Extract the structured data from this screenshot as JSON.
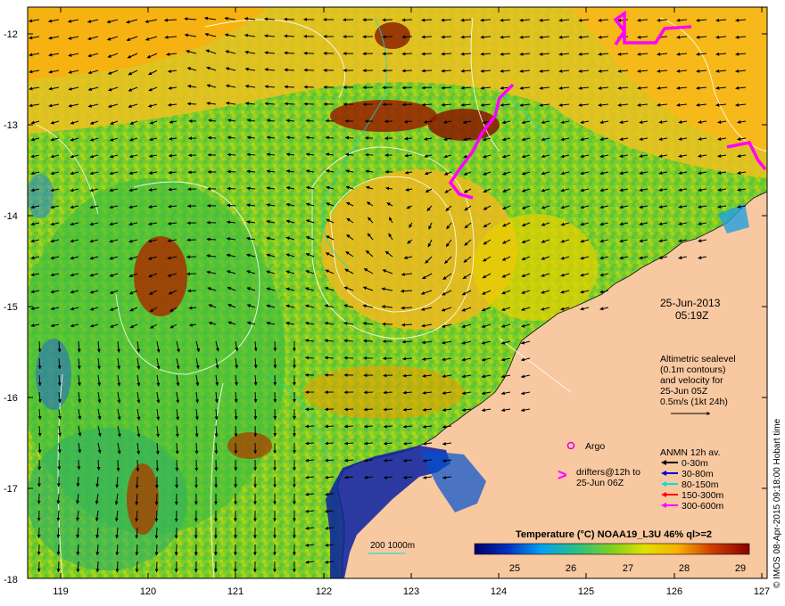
{
  "map": {
    "date": "25-Jun-2013",
    "time": "05:19Z",
    "lon_ticks": [
      "119",
      "120",
      "121",
      "122",
      "123",
      "124",
      "125",
      "126",
      "127"
    ],
    "lat_ticks": [
      "-12",
      "-13",
      "-14",
      "-15",
      "-16",
      "-17",
      "-18"
    ],
    "altimetry_lines": [
      "Altimetric sealevel",
      "(0.1m contours)",
      "and velocity for",
      "25-Jun 05Z",
      "0.5m/s (1kt 24h)"
    ],
    "argo_label": "Argo",
    "drifters_lines": [
      "drifters@12h to",
      "25-Jun 06Z"
    ],
    "anmn_title": "ANMN 12h av.",
    "anmn_items": [
      {
        "label": "0-30m",
        "color": "#000000"
      },
      {
        "label": "30-80m",
        "color": "#0000cc"
      },
      {
        "label": "80-150m",
        "color": "#00e0e0"
      },
      {
        "label": "150-300m",
        "color": "#ff0000"
      },
      {
        "label": "300-600m",
        "color": "#ff00ff"
      }
    ],
    "depth_label": "200  1000m",
    "colorbar_title": "Temperature (°C) NOAA19_L3U 46% ql>=2",
    "colorbar_ticks": [
      "25",
      "26",
      "27",
      "28",
      "29"
    ],
    "credit": "© IMOS 08-Apr-2015 09:18:00 Hobart time",
    "colors": {
      "land": "#f8c8a0",
      "frame": "#000000",
      "contour": "#ffffff",
      "bathy": "#00e0e0",
      "drifter": "#ff00ff"
    }
  }
}
